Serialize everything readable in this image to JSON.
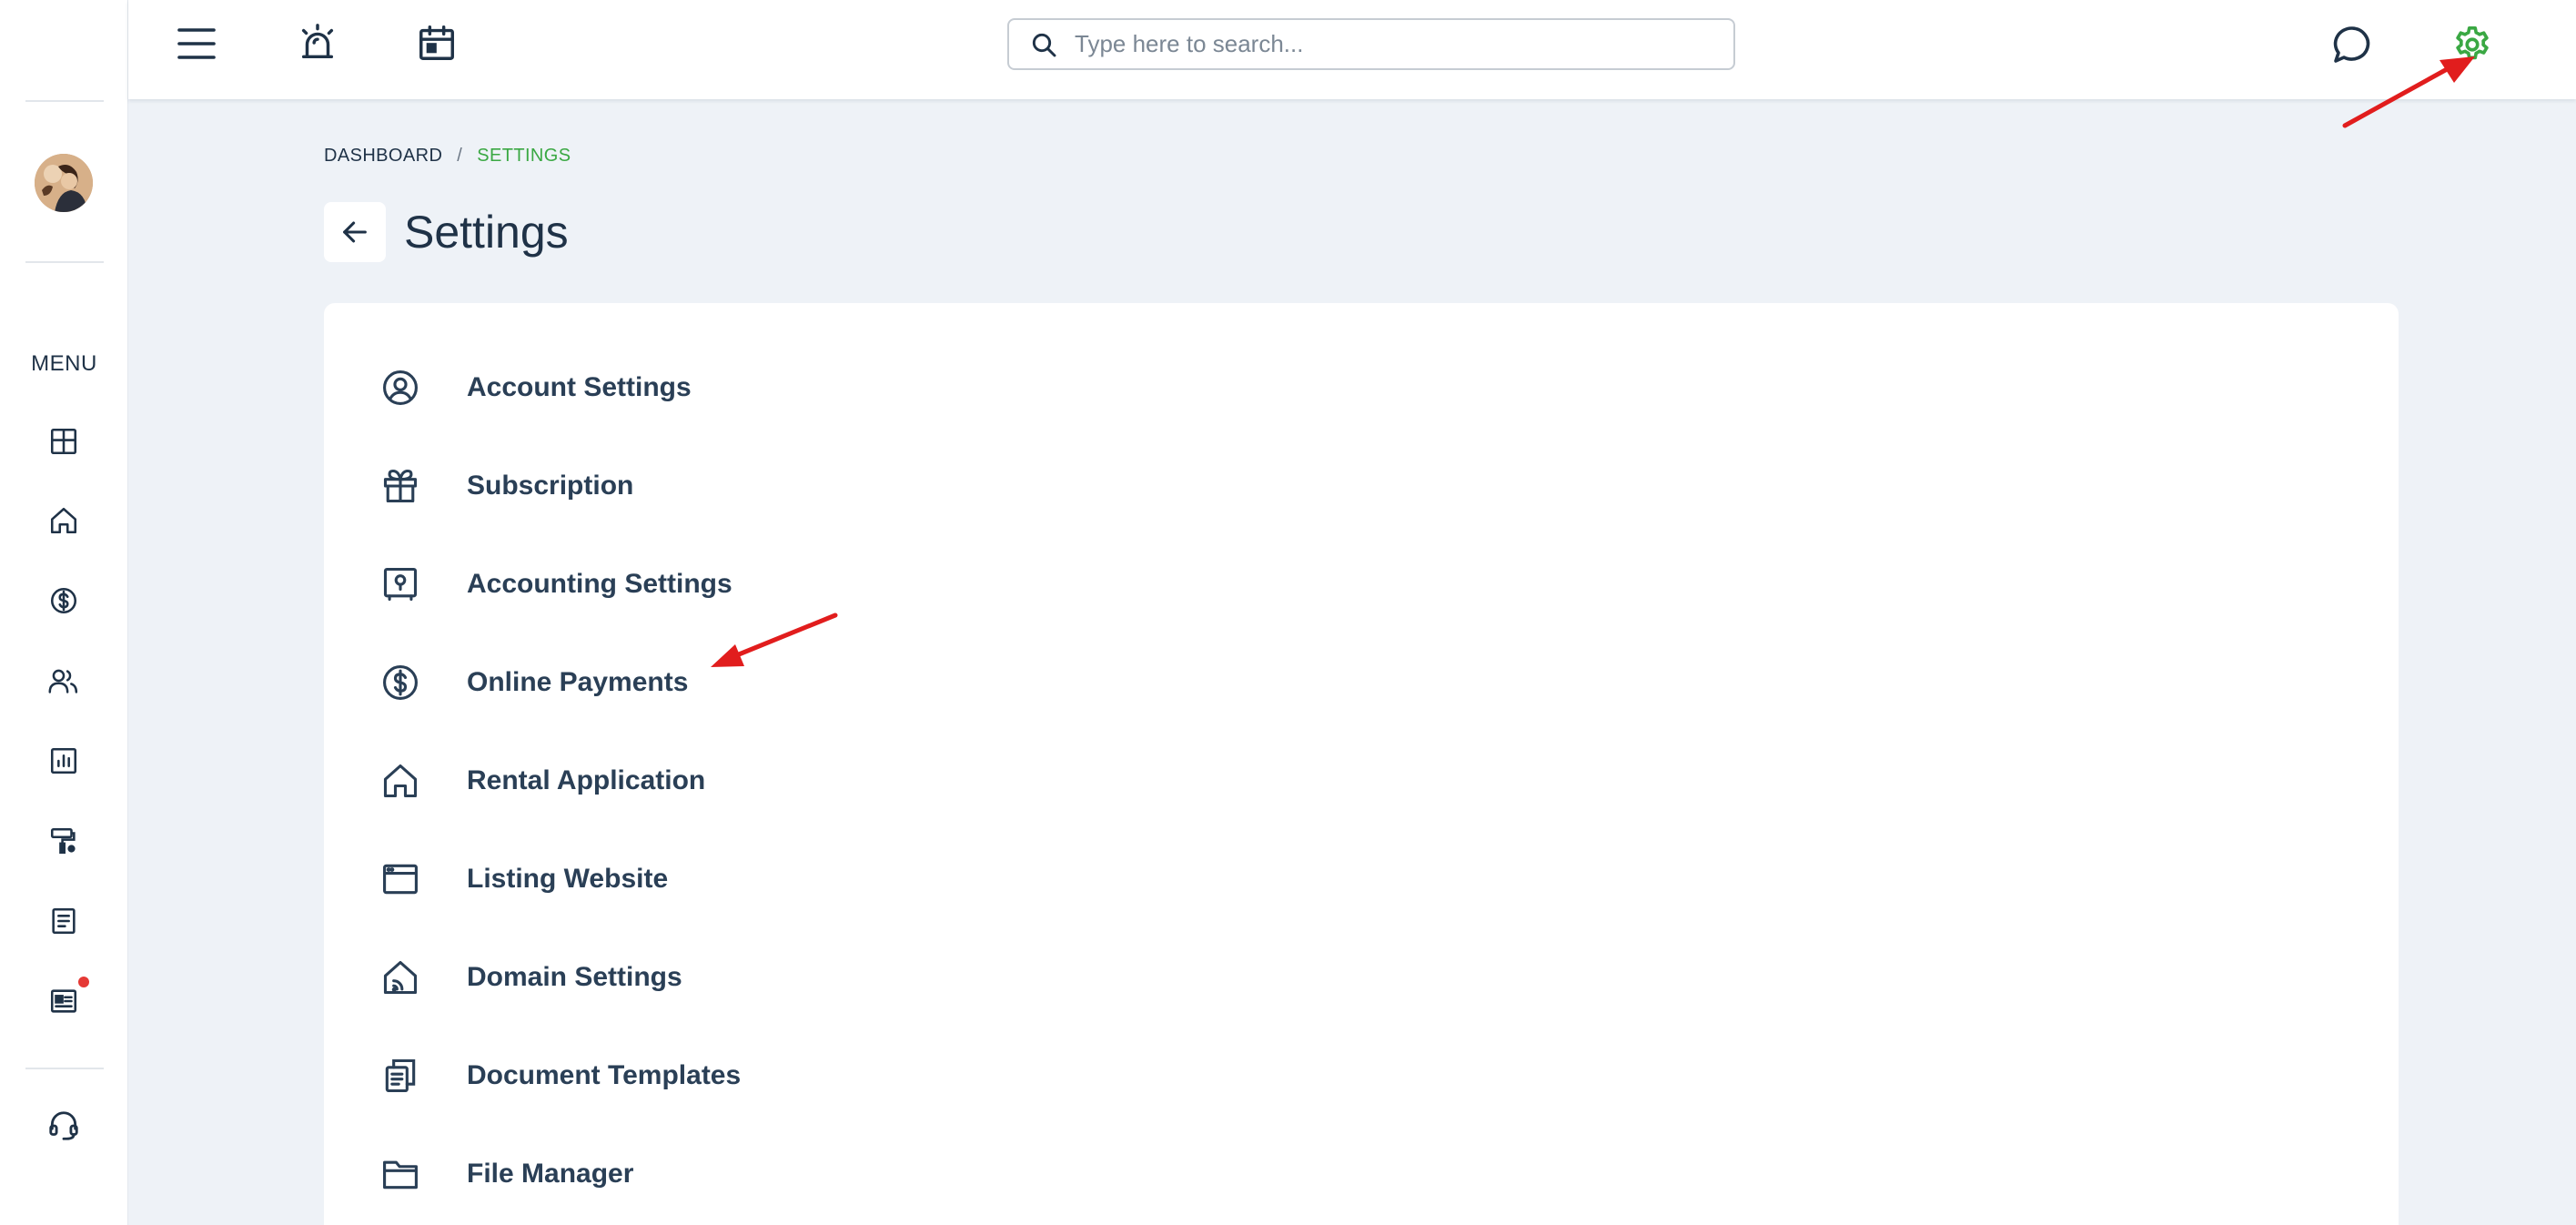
{
  "sidebar": {
    "menu_label": "MENU",
    "items": [
      {
        "icon": "dashboard-icon"
      },
      {
        "icon": "home-icon"
      },
      {
        "icon": "dollar-icon"
      },
      {
        "icon": "users-icon"
      },
      {
        "icon": "reports-icon"
      },
      {
        "icon": "maintenance-icon"
      },
      {
        "icon": "document-icon"
      },
      {
        "icon": "news-icon",
        "has_notification": true
      }
    ],
    "support_icon": "headset-icon"
  },
  "topbar": {
    "icons": [
      "hamburger-menu-icon",
      "alarm-icon",
      "calendar-icon"
    ],
    "search": {
      "placeholder": "Type here to search...",
      "value": ""
    },
    "right_icons": [
      "chat-icon",
      "gear-icon"
    ]
  },
  "breadcrumb": {
    "items": [
      "DASHBOARD",
      "SETTINGS"
    ],
    "separator": "/"
  },
  "page": {
    "title": "Settings"
  },
  "settings": {
    "items": [
      {
        "label": "Account Settings",
        "icon": "user-circle-icon"
      },
      {
        "label": "Subscription",
        "icon": "gift-icon"
      },
      {
        "label": "Accounting Settings",
        "icon": "safe-icon"
      },
      {
        "label": "Online Payments",
        "icon": "dollar-circle-icon"
      },
      {
        "label": "Rental Application",
        "icon": "home-icon"
      },
      {
        "label": "Listing Website",
        "icon": "browser-window-icon"
      },
      {
        "label": "Domain Settings",
        "icon": "home-wifi-icon"
      },
      {
        "label": "Document Templates",
        "icon": "documents-icon"
      },
      {
        "label": "File Manager",
        "icon": "folder-icon"
      }
    ]
  },
  "colors": {
    "accent_green": "#3aa843",
    "text_dark": "#1f3247",
    "background": "#eef2f7",
    "annotation_red": "#e11d1d",
    "notification_red": "#e53935"
  }
}
